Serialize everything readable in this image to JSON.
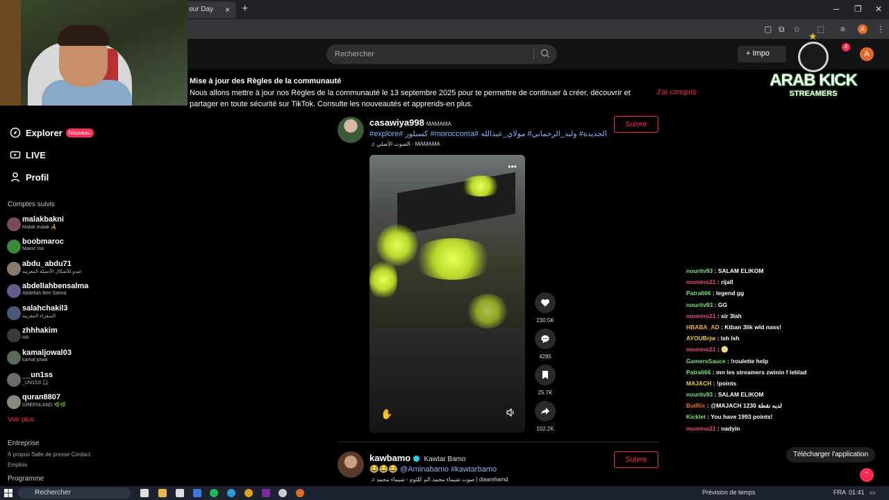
{
  "browser": {
    "tab_title": "our Day",
    "tab_close": "×",
    "new_tab": "+",
    "profile_initial": "A",
    "min": "─",
    "restore": "❐",
    "close": "✕"
  },
  "header": {
    "search_placeholder": "Rechercher",
    "upload_label": "+ Impo",
    "notif_count": "4",
    "profile_initial": "A"
  },
  "notice": {
    "title": "Mise à jour des Règles de la communauté",
    "body": "Nous allons mettre à jour nos Règles de la communauté le 13 septembre 2025 pour te permettre de continuer à créer, découvrir et partager en toute sécurité sur TikTok. Consulte les nouveautés et apprends-en plus.",
    "ok": "J'ai compris"
  },
  "logo": {
    "line1": "ARAB KICK",
    "line2": "STREAMERS"
  },
  "sidebar": {
    "nav": [
      {
        "label": "Explorer",
        "badge": "Nouveau",
        "icon": "compass-icon"
      },
      {
        "label": "LIVE",
        "icon": "live-icon"
      },
      {
        "label": "Profil",
        "icon": "user-icon"
      }
    ],
    "following_title": "Comptes suivis",
    "accounts": [
      {
        "name": "malakbakni",
        "sub": "Malak malak 🦂",
        "color": "#7a4b5c"
      },
      {
        "name": "boobmaroc",
        "sub": "Maroc ma",
        "color": "#3a8a3a"
      },
      {
        "name": "abdu_abdu71",
        "sub": "عبدو للأشكال الأصيلة المغربية",
        "color": "#8a7a6a"
      },
      {
        "name": "abdellahbensalma",
        "sub": "Abdellah Ben Salma",
        "color": "#6a5a8a"
      },
      {
        "name": "salahchakil3",
        "sub": "السفراء المغربية",
        "color": "#4a5a7a"
      },
      {
        "name": "zhhhakim",
        "sub": "HA",
        "color": "#3a3a3a"
      },
      {
        "name": "kamaljowal03",
        "sub": "kamal jowal",
        "color": "#5a6a5a"
      },
      {
        "name": "__un1ss",
        "sub": "_UN1SS 🎧",
        "color": "#6a6a6a"
      },
      {
        "name": "quran8807",
        "sub": "GREENLAND 🌿🌿",
        "color": "#8a8a7a"
      }
    ],
    "see_more": "Voir plus",
    "company_title": "Entreprise",
    "company_links": "À propos  Salle de presse  Contact",
    "jobs": "Emplois",
    "program_title": "Programme"
  },
  "post1": {
    "username": "casawiya998",
    "nickname": "MAMAMA",
    "caption": "#explore# كسبلور #moroccoma# الجديدة# وليد_الرحماني# مولاي_عبدالله",
    "music": "♫  الصوت الأصلي - MAMAMA",
    "follow": "Suivre",
    "more": "•••",
    "likes": "230.5K",
    "comments": "4285",
    "saves": "25.7K",
    "shares": "102.2K"
  },
  "post2": {
    "username": "kawbamo",
    "nickname": "Kawtar Bamo",
    "caption": "😂😂😂 @Aminabamo #kawtarbamo",
    "music": "♫  صوت شيماء محمد الم كلثوم - شيماء محمد | diaamhamd",
    "follow": "Suivre"
  },
  "chat": [
    {
      "user": "nouritv93",
      "color": "#7fe07f",
      "msg": "SALAM ELIKOM"
    },
    {
      "user": "momino21",
      "color": "#e0508a",
      "msg": "rijall"
    },
    {
      "user": "Patra666",
      "color": "#7fe07f",
      "msg": "legend gg"
    },
    {
      "user": "nouritv93",
      "color": "#7fe07f",
      "msg": "GG"
    },
    {
      "user": "momino21",
      "color": "#e0508a",
      "msg": "sir 3lah"
    },
    {
      "user": "HBABA_AD",
      "color": "#f0b040",
      "msg": "Ktban 3lik wld nass!"
    },
    {
      "user": "AYOUBrjw",
      "color": "#f0d040",
      "msg": "lsh lsh"
    },
    {
      "user": "momino21",
      "color": "#e0508a",
      "msg": "🌝"
    },
    {
      "user": "GamersSauce",
      "color": "#7fe07f",
      "msg": "!roulette help"
    },
    {
      "user": "Patra666",
      "color": "#7fe07f",
      "msg": "mn les streamers zwinin f leblad"
    },
    {
      "user": "MAJACH",
      "color": "#f0d040",
      "msg": "!points"
    },
    {
      "user": "nouritv93",
      "color": "#7fe07f",
      "msg": "SALAM ELIKOM"
    },
    {
      "user": "BotRix",
      "color": "#f07030",
      "msg": "@MAJACH 1230 لديه نقطة"
    },
    {
      "user": "Kicklet",
      "color": "#7fe07f",
      "msg": "You have 1993 points!"
    },
    {
      "user": "momino21",
      "color": "#e0508a",
      "msg": "nadyin"
    }
  ],
  "download_app": "Télécharger l'application",
  "taskbar": {
    "search": "Rechercher",
    "weather": "Prévision de temps",
    "lang": "FRA",
    "time": "01:41"
  }
}
